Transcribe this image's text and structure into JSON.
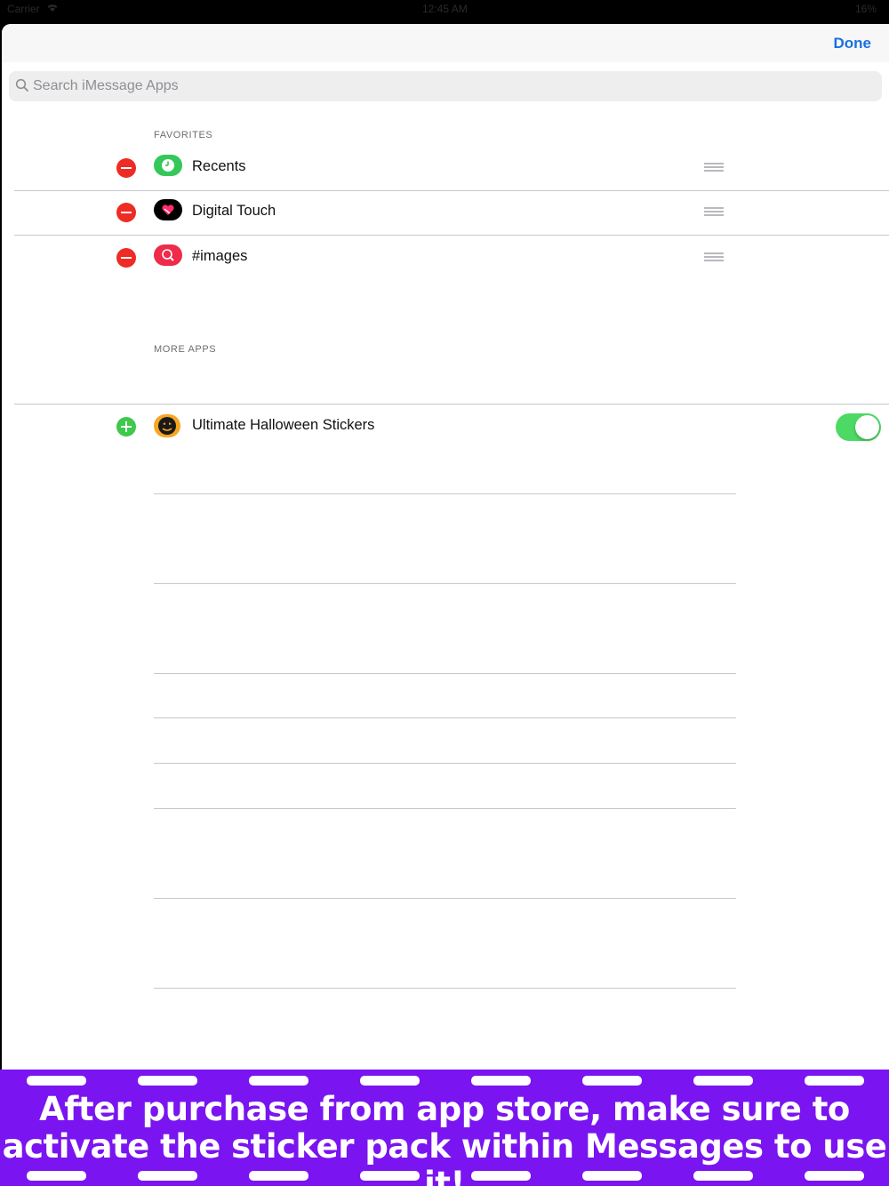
{
  "status_bar": {
    "carrier": "Carrier",
    "time": "12:45 AM",
    "battery": "16%"
  },
  "nav": {
    "done_label": "Done"
  },
  "search": {
    "placeholder": "Search iMessage Apps"
  },
  "favorites": {
    "header": "FAVORITES",
    "items": [
      {
        "label": "Recents",
        "icon": "clock-icon",
        "color": "#34c759"
      },
      {
        "label": "Digital Touch",
        "icon": "heart-touch-icon",
        "color": "#000000"
      },
      {
        "label": "#images",
        "icon": "image-search-icon",
        "color": "#ee2b4a"
      }
    ]
  },
  "more_apps": {
    "header": "MORE APPS",
    "items": [
      {
        "label": "Ultimate Halloween Stickers",
        "icon": "pumpkin-icon",
        "enabled": true
      }
    ]
  },
  "promo": {
    "line1": "After purchase from app store, make sure to",
    "line2": "activate the sticker pack within Messages to use it!",
    "background": "#7a14f0"
  }
}
